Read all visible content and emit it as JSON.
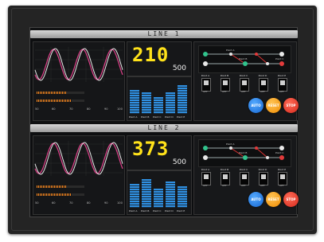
{
  "lines": [
    {
      "title": "LINE 1",
      "value": "210",
      "setpoint": "500",
      "ticks": [
        "50",
        "60",
        "70",
        "80",
        "90",
        "100"
      ],
      "bar_labels": [
        "Point A",
        "Point B",
        "Point C",
        "Point D",
        "Point E"
      ],
      "bar_values": [
        0.82,
        0.68,
        0.55,
        0.72,
        0.9
      ],
      "progress": [
        0.62,
        0.74
      ],
      "flow_labels": [
        "Point A",
        "Point B",
        "Point C"
      ],
      "switches": [
        {
          "label": "Point A",
          "state": "OFF"
        },
        {
          "label": "Point B",
          "state": "OFF"
        },
        {
          "label": "Point C",
          "state": "OFF"
        },
        {
          "label": "Point D",
          "state": "OFF"
        },
        {
          "label": "Point E",
          "state": "OFF"
        }
      ],
      "buttons": {
        "auto": "AUTO",
        "reset": "RESET",
        "stop": "STOP"
      }
    },
    {
      "title": "LINE 2",
      "value": "373",
      "setpoint": "500",
      "ticks": [
        "50",
        "60",
        "70",
        "80",
        "90",
        "100"
      ],
      "bar_labels": [
        "Point A",
        "Point B",
        "Point C",
        "Point D",
        "Point E"
      ],
      "bar_values": [
        0.78,
        0.92,
        0.6,
        0.85,
        0.7
      ],
      "progress": [
        0.62,
        0.74
      ],
      "flow_labels": [
        "Point A",
        "Point B",
        "Point C"
      ],
      "switches": [
        {
          "label": "Point A",
          "state": "OFF"
        },
        {
          "label": "Point B",
          "state": "OFF"
        },
        {
          "label": "Point C",
          "state": "OFF"
        },
        {
          "label": "Point D",
          "state": "OFF"
        },
        {
          "label": "Point E",
          "state": "OFF"
        }
      ],
      "buttons": {
        "auto": "AUTO",
        "reset": "RESET",
        "stop": "STOP"
      }
    }
  ],
  "colors": {
    "accent_yellow": "#ffe21a",
    "wave_white": "#e8e8e8",
    "wave_magenta": "#e0408a",
    "bar_blue": "#2f8fe0",
    "progress_orange": "#ff8a1e",
    "button_auto": "#1e7ae6",
    "button_reset": "#f5a000",
    "button_stop": "#e03a2a",
    "node_green": "#31c48d",
    "node_red": "#e23b3b"
  }
}
